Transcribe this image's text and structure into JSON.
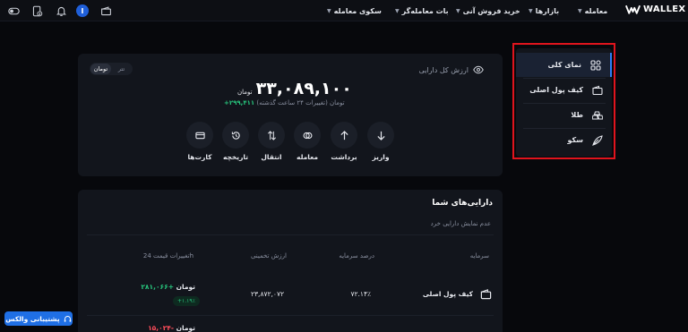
{
  "topbar": {
    "brand": "WALLEX",
    "nav": [
      {
        "label": "معامله"
      },
      {
        "label": "بازارها"
      },
      {
        "label": "خرید فروش آنی"
      },
      {
        "label": "بات معامله‌گر"
      },
      {
        "label": "سکوی معامله"
      }
    ],
    "user_initial": "I"
  },
  "side_menu": {
    "items": [
      {
        "label": "نمای کلی",
        "icon": "dashboard-icon",
        "active": true
      },
      {
        "label": "کیف پول اصلی",
        "icon": "wallet-icon",
        "active": false
      },
      {
        "label": "طلا",
        "icon": "gold-bars-icon",
        "active": false
      },
      {
        "label": "سکو",
        "icon": "leaf-icon",
        "active": false
      }
    ]
  },
  "overview": {
    "title": "ارزش کل دارایی",
    "currency_toggle": [
      "تومان",
      "تتر"
    ],
    "selected_currency": "تومان",
    "balance": "۳۳,۰۸۹,۱۰۰",
    "balance_unit": "تومان",
    "change_value": "+۲۹۹,۴۱۱",
    "change_text": "تومان (تغییرات ۲۴ ساعت گذشته)",
    "actions": [
      {
        "label": "واریز",
        "icon": "arrow-down-icon"
      },
      {
        "label": "برداشت",
        "icon": "arrow-up-icon"
      },
      {
        "label": "معامله",
        "icon": "trade-icon"
      },
      {
        "label": "انتقال",
        "icon": "transfer-icon"
      },
      {
        "label": "تاریخچه",
        "icon": "history-icon"
      },
      {
        "label": "کارت‌ها",
        "icon": "card-icon"
      }
    ]
  },
  "assets": {
    "title": "دارایی‌های شما",
    "hide_small": "عدم نمایش دارایی خرد",
    "columns": [
      "سرمایه",
      "درصد سرمایه",
      "ارزش تخمینی",
      "تغییرات قیمت 24h"
    ],
    "rows": [
      {
        "name": "کیف پول اصلی",
        "percent": "۷۲.۱۴٪",
        "estimated": "۲۳,۸۷۲,۰۷۲",
        "change_value": "+۲۸۱,۰۶۶",
        "change_unit": "تومان",
        "change_pct": "+۱.۱۹٪"
      }
    ],
    "next_row_partial": {
      "change_value": "-۱۵,۰۲۴",
      "change_unit": "تومان"
    }
  },
  "support": {
    "label": "پشتیبانی والکس"
  },
  "colors": {
    "background": "#07080c",
    "card": "#12151c",
    "accent": "#2e7df6",
    "positive": "#27c27b",
    "negative": "#ff4d5a",
    "highlight_box": "#e0141d"
  }
}
